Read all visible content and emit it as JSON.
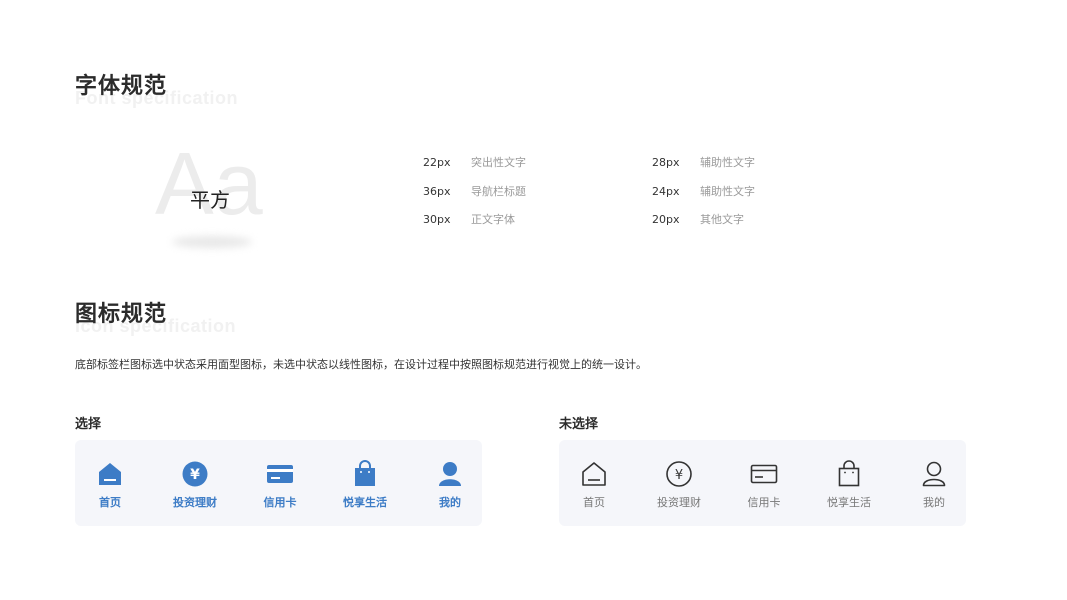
{
  "font_section": {
    "title": "字体规范",
    "subtitle": "Font specification",
    "demo_glyph": "Aa",
    "demo_font_name": "平方",
    "specs": [
      {
        "size": "22px",
        "label": "突出性文字"
      },
      {
        "size": "36px",
        "label": "导航栏标题"
      },
      {
        "size": "30px",
        "label": "正文字体"
      },
      {
        "size": "28px",
        "label": "辅助性文字"
      },
      {
        "size": "24px",
        "label": "辅助性文字"
      },
      {
        "size": "20px",
        "label": "其他文字"
      }
    ]
  },
  "icon_section": {
    "title": "图标规范",
    "subtitle": "Icon specification",
    "description": "底部标签栏图标选中状态采用面型图标，未选中状态以线性图标，在设计过程中按照图标规范进行视觉上的统一设计。",
    "selected_label": "选择",
    "unselected_label": "未选择",
    "tabs": [
      "首页",
      "投资理财",
      "信用卡",
      "悦享生活",
      "我的"
    ]
  },
  "colors": {
    "accent": "#3d7cc6",
    "outline": "#333333",
    "tabbar_bg": "#f5f6fa"
  },
  "icons": [
    "home-icon",
    "yuan-icon",
    "credit-card-icon",
    "shopping-bag-icon",
    "user-icon"
  ]
}
